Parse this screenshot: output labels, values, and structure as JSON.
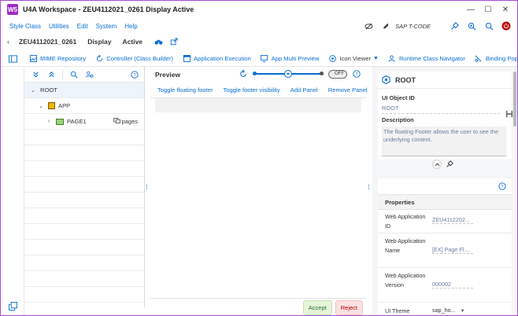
{
  "window": {
    "logo_text": "W5",
    "title": "U4A Workspace - ZEU4112021_0261 Display Active",
    "controls": [
      "—",
      "☐",
      "✕"
    ]
  },
  "menu": {
    "items": [
      "Style Class",
      "Utilities",
      "Edit",
      "System",
      "Help"
    ],
    "tcode_label": "SAP T-CODE"
  },
  "header": {
    "app_id": "ZEU4112021_0261",
    "mode": "Display",
    "status": "Active"
  },
  "toolbar": {
    "buttons": [
      "MIME Repository",
      "Controller (Class Builder)",
      "Application Execution",
      "App Multi Preview",
      "Icon Viewer",
      "Runtime Class Navigator",
      "Binding Popup"
    ]
  },
  "tree": {
    "rows": [
      {
        "label": "ROOT"
      },
      {
        "label": "APP"
      },
      {
        "label": "PAGE1",
        "tag": "pages"
      }
    ]
  },
  "preview": {
    "title": "Preview",
    "toggle_label": "OFF",
    "slider_value": 0.5,
    "buttons": [
      "Toggle floating footer",
      "Toggle footer visibility",
      "Add Panel",
      "Remove Panel"
    ],
    "accept": "Accept",
    "reject": "Reject"
  },
  "inspector": {
    "title": "ROOT",
    "ui_object_id_label": "UI Object ID",
    "ui_object_id": "ROOT",
    "description_label": "Description",
    "description": "The floating Footer allows the user to see the underlying content.",
    "properties_title": "Properties",
    "properties": [
      {
        "label": "Web Application ID",
        "value": "ZEU4112202..."
      },
      {
        "label": "Web Application Name",
        "value": "[EX] Page Fl..."
      },
      {
        "label": "Web Application Version",
        "value": "000002"
      },
      {
        "label": "UI Theme",
        "value": "sap_ho..."
      }
    ]
  },
  "colors": {
    "accent": "#0a6ed1",
    "brand": "#a32cc4",
    "accept_bg": "#e6f4d9",
    "reject_bg": "#fbe2e2"
  }
}
